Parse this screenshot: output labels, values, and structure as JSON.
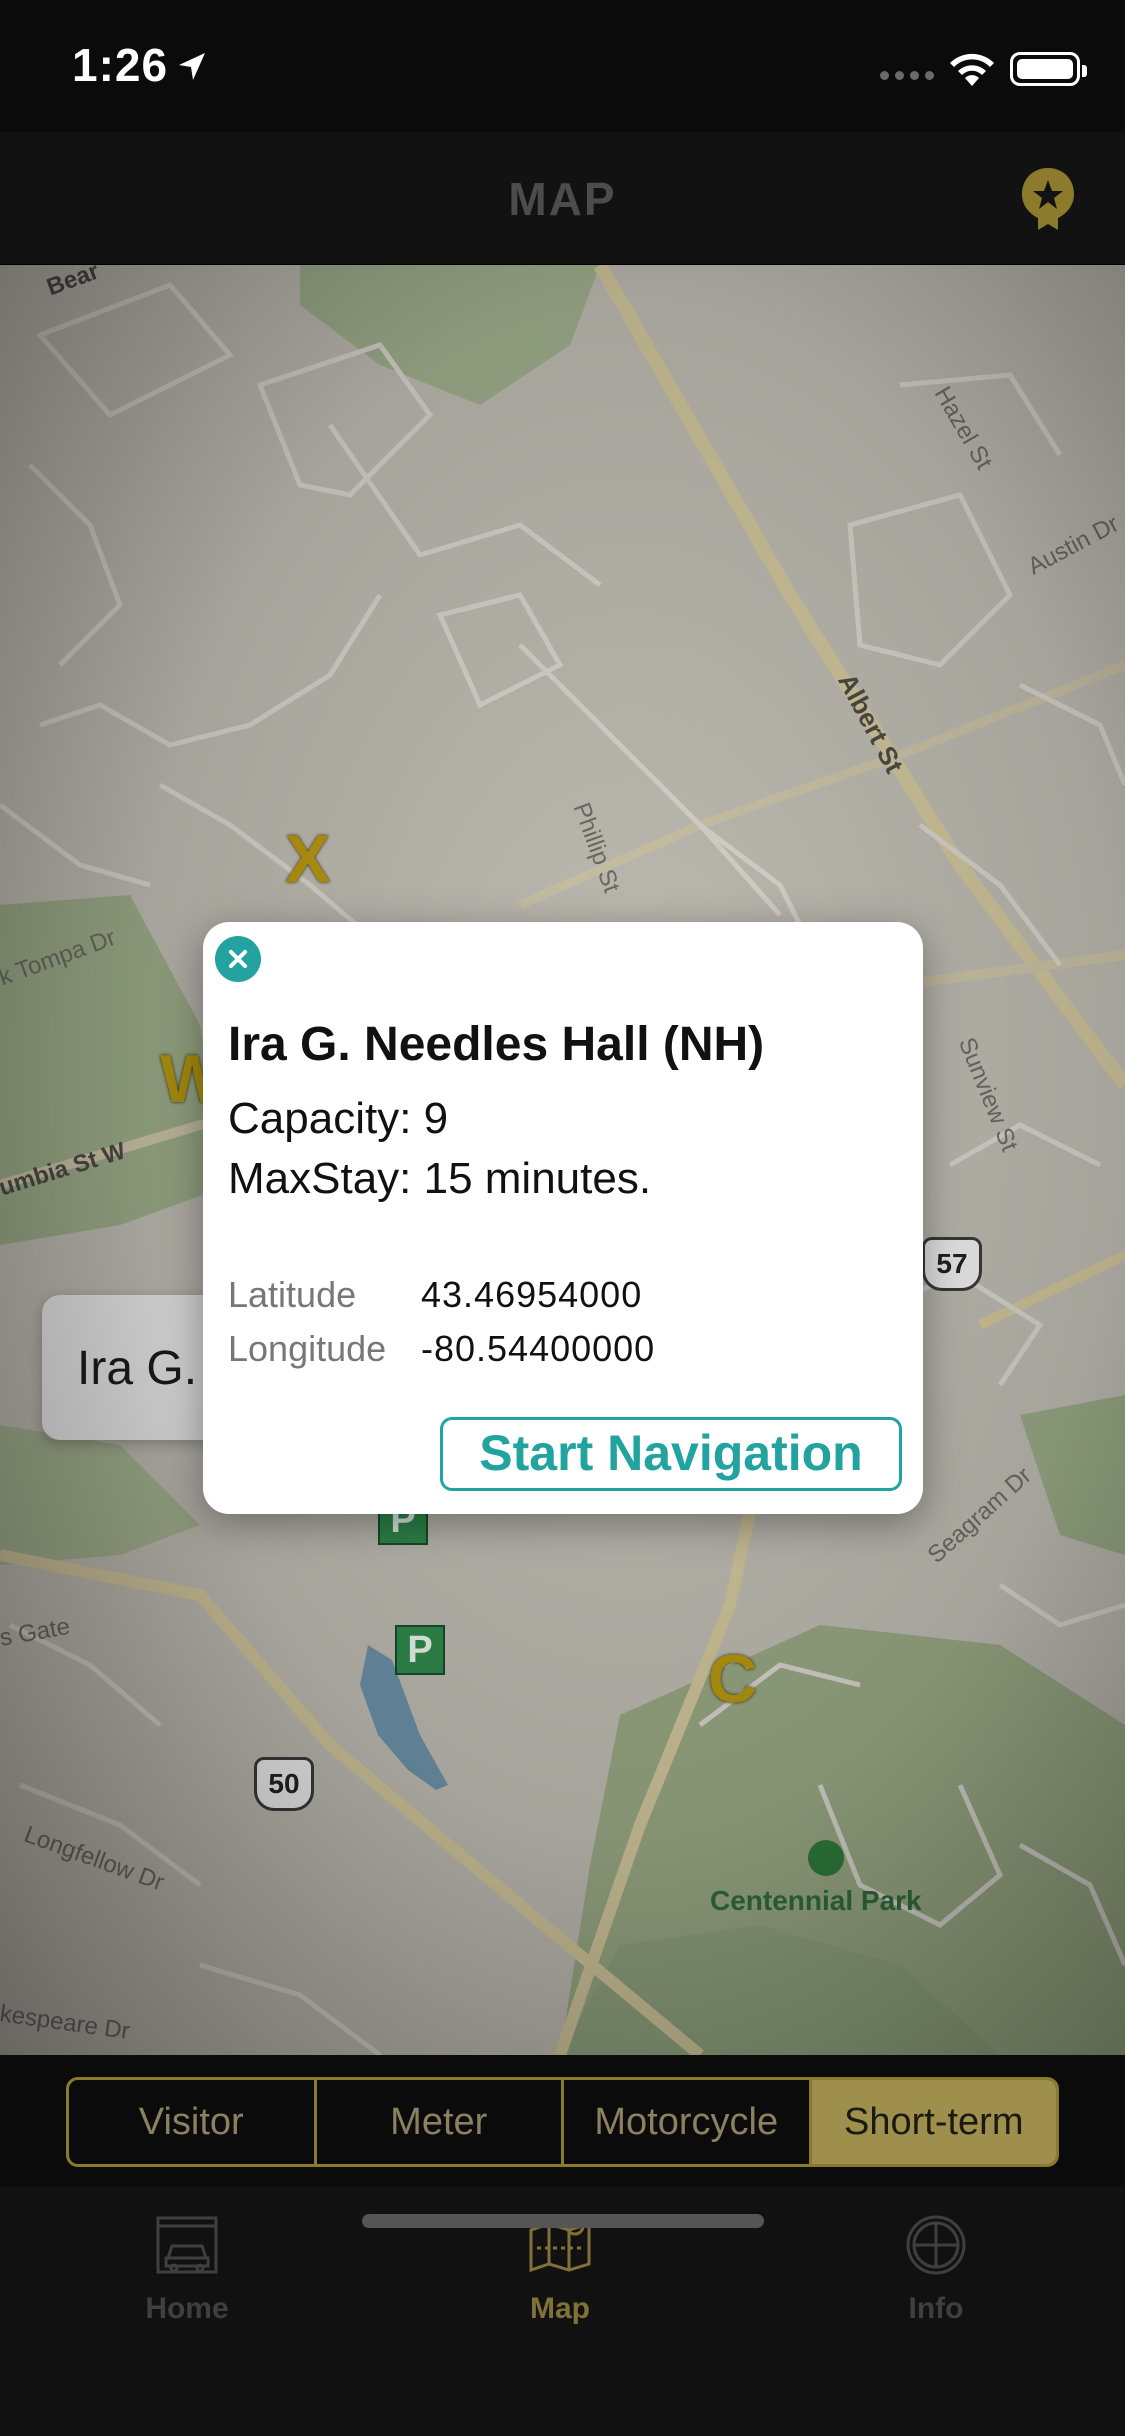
{
  "status_bar": {
    "time": "1:26"
  },
  "navbar": {
    "title": "MAP"
  },
  "map": {
    "streets": [
      "Hazel St",
      "Austin Dr",
      "Albert St",
      "Phillip St",
      "Sunview St",
      "Seagram Dr",
      "k Tompa Dr",
      "umbia St W",
      "s Gate",
      "Longfellow Dr",
      "kespeare Dr",
      "Bear"
    ],
    "lot_letters": [
      "X",
      "W",
      "C"
    ],
    "parking_marker": "P",
    "route_shields": [
      "57",
      "50"
    ],
    "park_label": "Centennial Park",
    "callout": {
      "text": "Ira G. Needles Hall (NH)",
      "info": "i"
    }
  },
  "popup": {
    "title": "Ira G. Needles Hall (NH)",
    "capacity": "Capacity: 9",
    "maxstay": "MaxStay: 15 minutes.",
    "latitude_label": "Latitude",
    "latitude_value": "43.46954000",
    "longitude_label": "Longitude",
    "longitude_value": "-80.54400000",
    "nav_button": "Start Navigation",
    "accent_color": "#22a39f"
  },
  "segments": {
    "items": [
      "Visitor",
      "Meter",
      "Motorcycle",
      "Short-term"
    ],
    "selected": "Short-term"
  },
  "tabbar": {
    "items": [
      {
        "label": "Home",
        "icon": "garage-car-icon"
      },
      {
        "label": "Map",
        "icon": "map-icon"
      },
      {
        "label": "Info",
        "icon": "compass-icon"
      }
    ],
    "selected": "Map"
  }
}
